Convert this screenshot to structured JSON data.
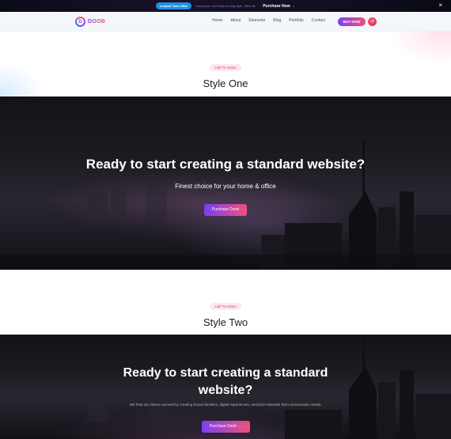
{
  "topbar": {
    "badge": "Limited Time Offer",
    "text": "Intro price. Get Doob for Big Sale -95% off.",
    "link": "Purchase Now →",
    "close_icon": "close-icon"
  },
  "header": {
    "logo_letter": "D",
    "logo_text": "DOOB",
    "nav": [
      "Home",
      "About",
      "Elements",
      "Blog",
      "Portfolio",
      "Contact"
    ],
    "buy_label": "BUY NOW",
    "round_icon": "↺"
  },
  "style_one": {
    "pill": "Call To Action",
    "title": "Style One"
  },
  "cta_one": {
    "title": "Ready to start creating a standard website?",
    "subtitle": "Finest choice for your home & office",
    "button": "Purchase Doob"
  },
  "style_two": {
    "pill": "Call To Action",
    "title": "Style Two"
  },
  "cta_two": {
    "title_line1": "Ready to start creating a standard",
    "title_line2": "website?",
    "subtitle": "We help our clients succeed by creating brand identities, digital experiences, and print materials that communicate clearly.",
    "button": "Purchase Doob →"
  },
  "colors": {
    "accent_purple": "#7b3ff6",
    "accent_pink": "#f0507a",
    "topbar_badge": "#1f8fe6"
  }
}
